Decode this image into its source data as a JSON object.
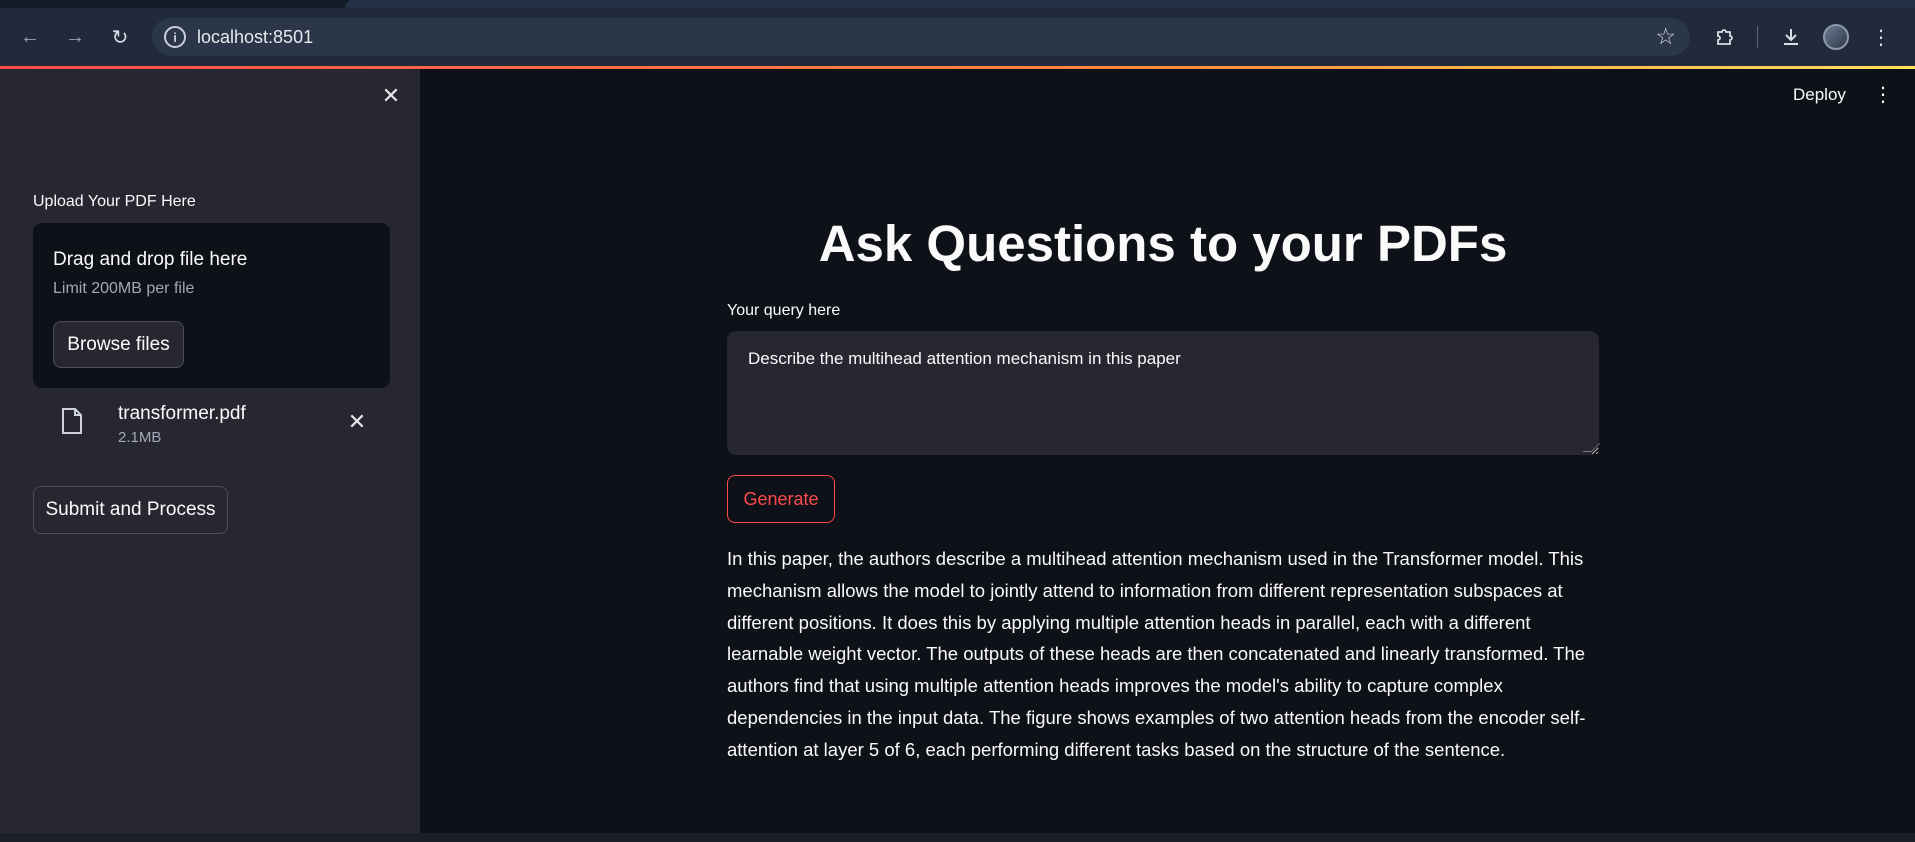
{
  "browser": {
    "url": "localhost:8501"
  },
  "sidebar": {
    "upload_label": "Upload Your PDF Here",
    "dropzone_title": "Drag and drop file here",
    "dropzone_limit": "Limit 200MB per file",
    "browse_label": "Browse files",
    "uploaded_file": {
      "name": "transformer.pdf",
      "size": "2.1MB"
    },
    "submit_label": "Submit and Process"
  },
  "header": {
    "deploy_label": "Deploy"
  },
  "main": {
    "title": "Ask Questions to your PDFs",
    "query_label": "Your query here",
    "query_value": "Describe the multihead attention mechanism in this paper",
    "generate_label": "Generate",
    "answer_lines": [
      "In this paper, the authors describe a multihead attention mechanism used in the Transformer model. This",
      "mechanism allows the model to jointly attend to information from different representation subspaces at",
      "different positions. It does this by applying multiple attention heads in parallel, each with a different",
      "learnable weight vector. The outputs of these heads are then concatenated and linearly transformed. The",
      "authors find that using multiple attention heads improves the model's ability to capture complex",
      "dependencies in the input data. The figure shows examples of two attention heads from the encoder self-",
      "attention at layer 5 of 6, each performing different tasks based on the structure of the sentence."
    ]
  },
  "colors": {
    "accent": "#ff4b4b",
    "sidebar_bg": "#262730",
    "main_bg": "#0e1117"
  }
}
